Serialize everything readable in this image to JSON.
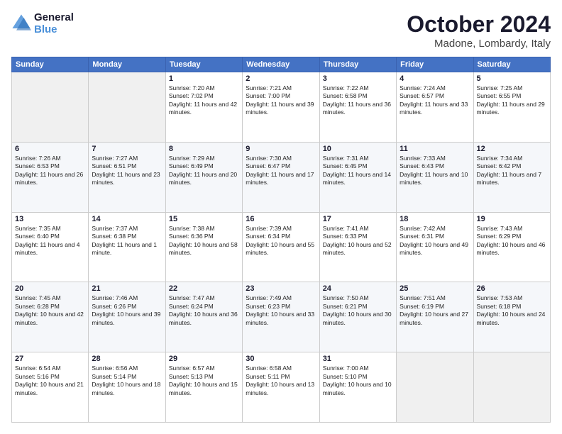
{
  "logo": {
    "line1": "General",
    "line2": "Blue"
  },
  "title": "October 2024",
  "subtitle": "Madone, Lombardy, Italy",
  "days_of_week": [
    "Sunday",
    "Monday",
    "Tuesday",
    "Wednesday",
    "Thursday",
    "Friday",
    "Saturday"
  ],
  "weeks": [
    [
      {
        "day": "",
        "sunrise": "",
        "sunset": "",
        "daylight": "",
        "empty": true
      },
      {
        "day": "",
        "sunrise": "",
        "sunset": "",
        "daylight": "",
        "empty": true
      },
      {
        "day": "1",
        "sunrise": "Sunrise: 7:20 AM",
        "sunset": "Sunset: 7:02 PM",
        "daylight": "Daylight: 11 hours and 42 minutes."
      },
      {
        "day": "2",
        "sunrise": "Sunrise: 7:21 AM",
        "sunset": "Sunset: 7:00 PM",
        "daylight": "Daylight: 11 hours and 39 minutes."
      },
      {
        "day": "3",
        "sunrise": "Sunrise: 7:22 AM",
        "sunset": "Sunset: 6:58 PM",
        "daylight": "Daylight: 11 hours and 36 minutes."
      },
      {
        "day": "4",
        "sunrise": "Sunrise: 7:24 AM",
        "sunset": "Sunset: 6:57 PM",
        "daylight": "Daylight: 11 hours and 33 minutes."
      },
      {
        "day": "5",
        "sunrise": "Sunrise: 7:25 AM",
        "sunset": "Sunset: 6:55 PM",
        "daylight": "Daylight: 11 hours and 29 minutes."
      }
    ],
    [
      {
        "day": "6",
        "sunrise": "Sunrise: 7:26 AM",
        "sunset": "Sunset: 6:53 PM",
        "daylight": "Daylight: 11 hours and 26 minutes."
      },
      {
        "day": "7",
        "sunrise": "Sunrise: 7:27 AM",
        "sunset": "Sunset: 6:51 PM",
        "daylight": "Daylight: 11 hours and 23 minutes."
      },
      {
        "day": "8",
        "sunrise": "Sunrise: 7:29 AM",
        "sunset": "Sunset: 6:49 PM",
        "daylight": "Daylight: 11 hours and 20 minutes."
      },
      {
        "day": "9",
        "sunrise": "Sunrise: 7:30 AM",
        "sunset": "Sunset: 6:47 PM",
        "daylight": "Daylight: 11 hours and 17 minutes."
      },
      {
        "day": "10",
        "sunrise": "Sunrise: 7:31 AM",
        "sunset": "Sunset: 6:45 PM",
        "daylight": "Daylight: 11 hours and 14 minutes."
      },
      {
        "day": "11",
        "sunrise": "Sunrise: 7:33 AM",
        "sunset": "Sunset: 6:43 PM",
        "daylight": "Daylight: 11 hours and 10 minutes."
      },
      {
        "day": "12",
        "sunrise": "Sunrise: 7:34 AM",
        "sunset": "Sunset: 6:42 PM",
        "daylight": "Daylight: 11 hours and 7 minutes."
      }
    ],
    [
      {
        "day": "13",
        "sunrise": "Sunrise: 7:35 AM",
        "sunset": "Sunset: 6:40 PM",
        "daylight": "Daylight: 11 hours and 4 minutes."
      },
      {
        "day": "14",
        "sunrise": "Sunrise: 7:37 AM",
        "sunset": "Sunset: 6:38 PM",
        "daylight": "Daylight: 11 hours and 1 minute."
      },
      {
        "day": "15",
        "sunrise": "Sunrise: 7:38 AM",
        "sunset": "Sunset: 6:36 PM",
        "daylight": "Daylight: 10 hours and 58 minutes."
      },
      {
        "day": "16",
        "sunrise": "Sunrise: 7:39 AM",
        "sunset": "Sunset: 6:34 PM",
        "daylight": "Daylight: 10 hours and 55 minutes."
      },
      {
        "day": "17",
        "sunrise": "Sunrise: 7:41 AM",
        "sunset": "Sunset: 6:33 PM",
        "daylight": "Daylight: 10 hours and 52 minutes."
      },
      {
        "day": "18",
        "sunrise": "Sunrise: 7:42 AM",
        "sunset": "Sunset: 6:31 PM",
        "daylight": "Daylight: 10 hours and 49 minutes."
      },
      {
        "day": "19",
        "sunrise": "Sunrise: 7:43 AM",
        "sunset": "Sunset: 6:29 PM",
        "daylight": "Daylight: 10 hours and 46 minutes."
      }
    ],
    [
      {
        "day": "20",
        "sunrise": "Sunrise: 7:45 AM",
        "sunset": "Sunset: 6:28 PM",
        "daylight": "Daylight: 10 hours and 42 minutes."
      },
      {
        "day": "21",
        "sunrise": "Sunrise: 7:46 AM",
        "sunset": "Sunset: 6:26 PM",
        "daylight": "Daylight: 10 hours and 39 minutes."
      },
      {
        "day": "22",
        "sunrise": "Sunrise: 7:47 AM",
        "sunset": "Sunset: 6:24 PM",
        "daylight": "Daylight: 10 hours and 36 minutes."
      },
      {
        "day": "23",
        "sunrise": "Sunrise: 7:49 AM",
        "sunset": "Sunset: 6:23 PM",
        "daylight": "Daylight: 10 hours and 33 minutes."
      },
      {
        "day": "24",
        "sunrise": "Sunrise: 7:50 AM",
        "sunset": "Sunset: 6:21 PM",
        "daylight": "Daylight: 10 hours and 30 minutes."
      },
      {
        "day": "25",
        "sunrise": "Sunrise: 7:51 AM",
        "sunset": "Sunset: 6:19 PM",
        "daylight": "Daylight: 10 hours and 27 minutes."
      },
      {
        "day": "26",
        "sunrise": "Sunrise: 7:53 AM",
        "sunset": "Sunset: 6:18 PM",
        "daylight": "Daylight: 10 hours and 24 minutes."
      }
    ],
    [
      {
        "day": "27",
        "sunrise": "Sunrise: 6:54 AM",
        "sunset": "Sunset: 5:16 PM",
        "daylight": "Daylight: 10 hours and 21 minutes."
      },
      {
        "day": "28",
        "sunrise": "Sunrise: 6:56 AM",
        "sunset": "Sunset: 5:14 PM",
        "daylight": "Daylight: 10 hours and 18 minutes."
      },
      {
        "day": "29",
        "sunrise": "Sunrise: 6:57 AM",
        "sunset": "Sunset: 5:13 PM",
        "daylight": "Daylight: 10 hours and 15 minutes."
      },
      {
        "day": "30",
        "sunrise": "Sunrise: 6:58 AM",
        "sunset": "Sunset: 5:11 PM",
        "daylight": "Daylight: 10 hours and 13 minutes."
      },
      {
        "day": "31",
        "sunrise": "Sunrise: 7:00 AM",
        "sunset": "Sunset: 5:10 PM",
        "daylight": "Daylight: 10 hours and 10 minutes."
      },
      {
        "day": "",
        "sunrise": "",
        "sunset": "",
        "daylight": "",
        "empty": true
      },
      {
        "day": "",
        "sunrise": "",
        "sunset": "",
        "daylight": "",
        "empty": true
      }
    ]
  ]
}
